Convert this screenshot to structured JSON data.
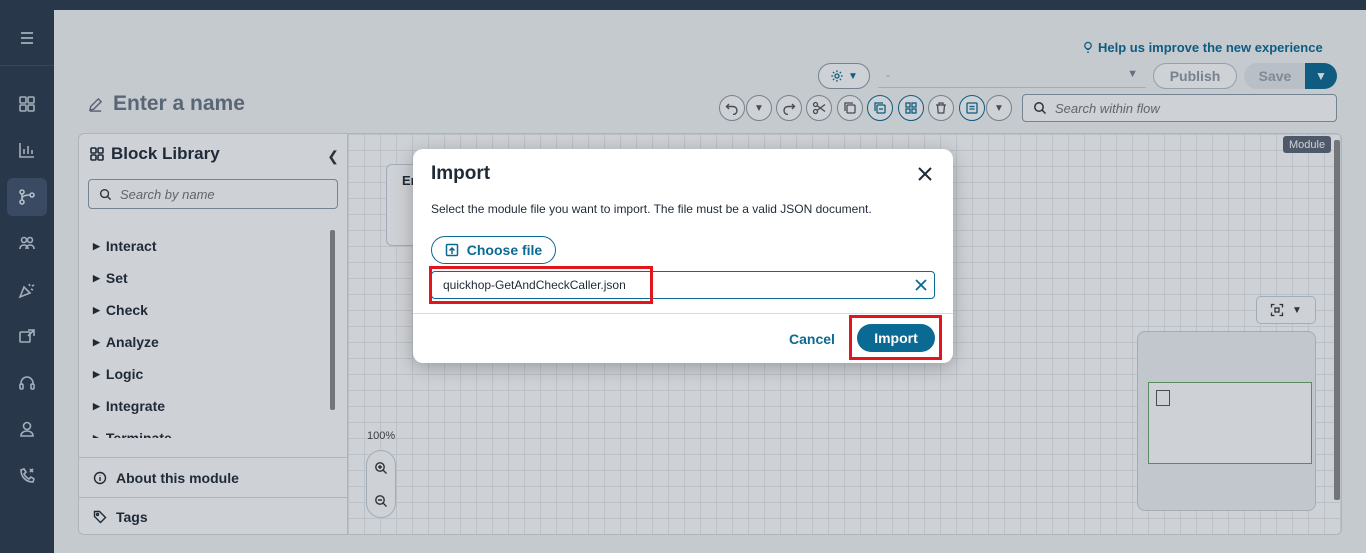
{
  "help_link": "Help us improve the new experience",
  "flow_name_placeholder": "Enter a name",
  "version_select": {
    "value": "-"
  },
  "toolbar": {
    "publish_label": "Publish",
    "save_label": "Save",
    "search_placeholder": "Search within flow"
  },
  "library": {
    "title": "Block Library",
    "search_placeholder": "Search by name",
    "categories": [
      "Interact",
      "Set",
      "Check",
      "Analyze",
      "Logic",
      "Integrate",
      "Terminate"
    ],
    "about_label": "About this module",
    "tags_label": "Tags"
  },
  "canvas": {
    "module_badge": "Module",
    "entry_label": "En",
    "zoom_level": "100%"
  },
  "modal": {
    "title": "Import",
    "description": "Select the module file you want to import. The file must be a valid JSON document.",
    "choose_file_label": "Choose file",
    "file_name": "quickhop-GetAndCheckCaller.json",
    "cancel_label": "Cancel",
    "import_label": "Import"
  },
  "colors": {
    "accent": "#0b6a93",
    "highlight": "#e3141b",
    "rail": "#2c3a4f"
  }
}
